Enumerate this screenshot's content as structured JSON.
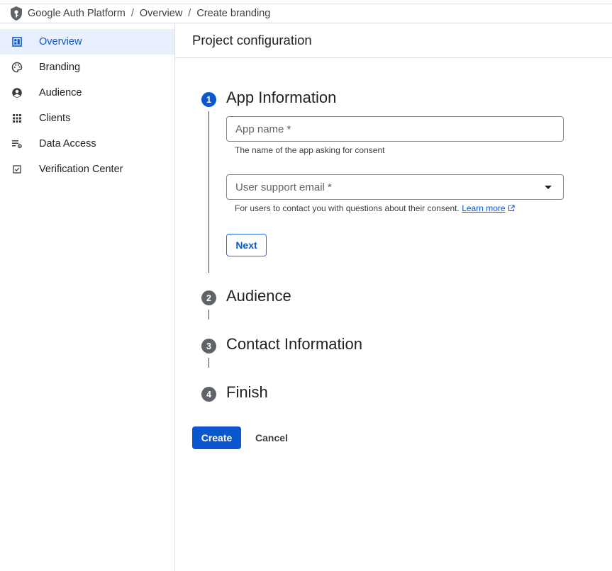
{
  "breadcrumb": {
    "app": "Google Auth Platform",
    "separator": "/",
    "overview": "Overview",
    "current": "Create branding"
  },
  "sidebar": {
    "items": [
      {
        "label": "Overview",
        "icon": "dashboard-icon",
        "active": true
      },
      {
        "label": "Branding",
        "icon": "palette-icon",
        "active": false
      },
      {
        "label": "Audience",
        "icon": "person-icon",
        "active": false
      },
      {
        "label": "Clients",
        "icon": "grid-icon",
        "active": false
      },
      {
        "label": "Data Access",
        "icon": "list-settings-icon",
        "active": false
      },
      {
        "label": "Verification Center",
        "icon": "checkbox-icon",
        "active": false
      }
    ]
  },
  "main": {
    "title": "Project configuration",
    "steps": [
      {
        "number": "1",
        "title": "App Information"
      },
      {
        "number": "2",
        "title": "Audience"
      },
      {
        "number": "3",
        "title": "Contact Information"
      },
      {
        "number": "4",
        "title": "Finish"
      }
    ],
    "app_name": {
      "placeholder": "App name *",
      "value": "",
      "hint": "The name of the app asking for consent"
    },
    "support_email": {
      "placeholder": "User support email *",
      "hint": "For users to contact you with questions about their consent.",
      "learn_more": "Learn more"
    },
    "next_label": "Next",
    "create_label": "Create",
    "cancel_label": "Cancel"
  },
  "colors": {
    "accent": "#0b57d0",
    "active_nav_bg": "#e8f0fe",
    "step_idle": "#5f6368"
  }
}
